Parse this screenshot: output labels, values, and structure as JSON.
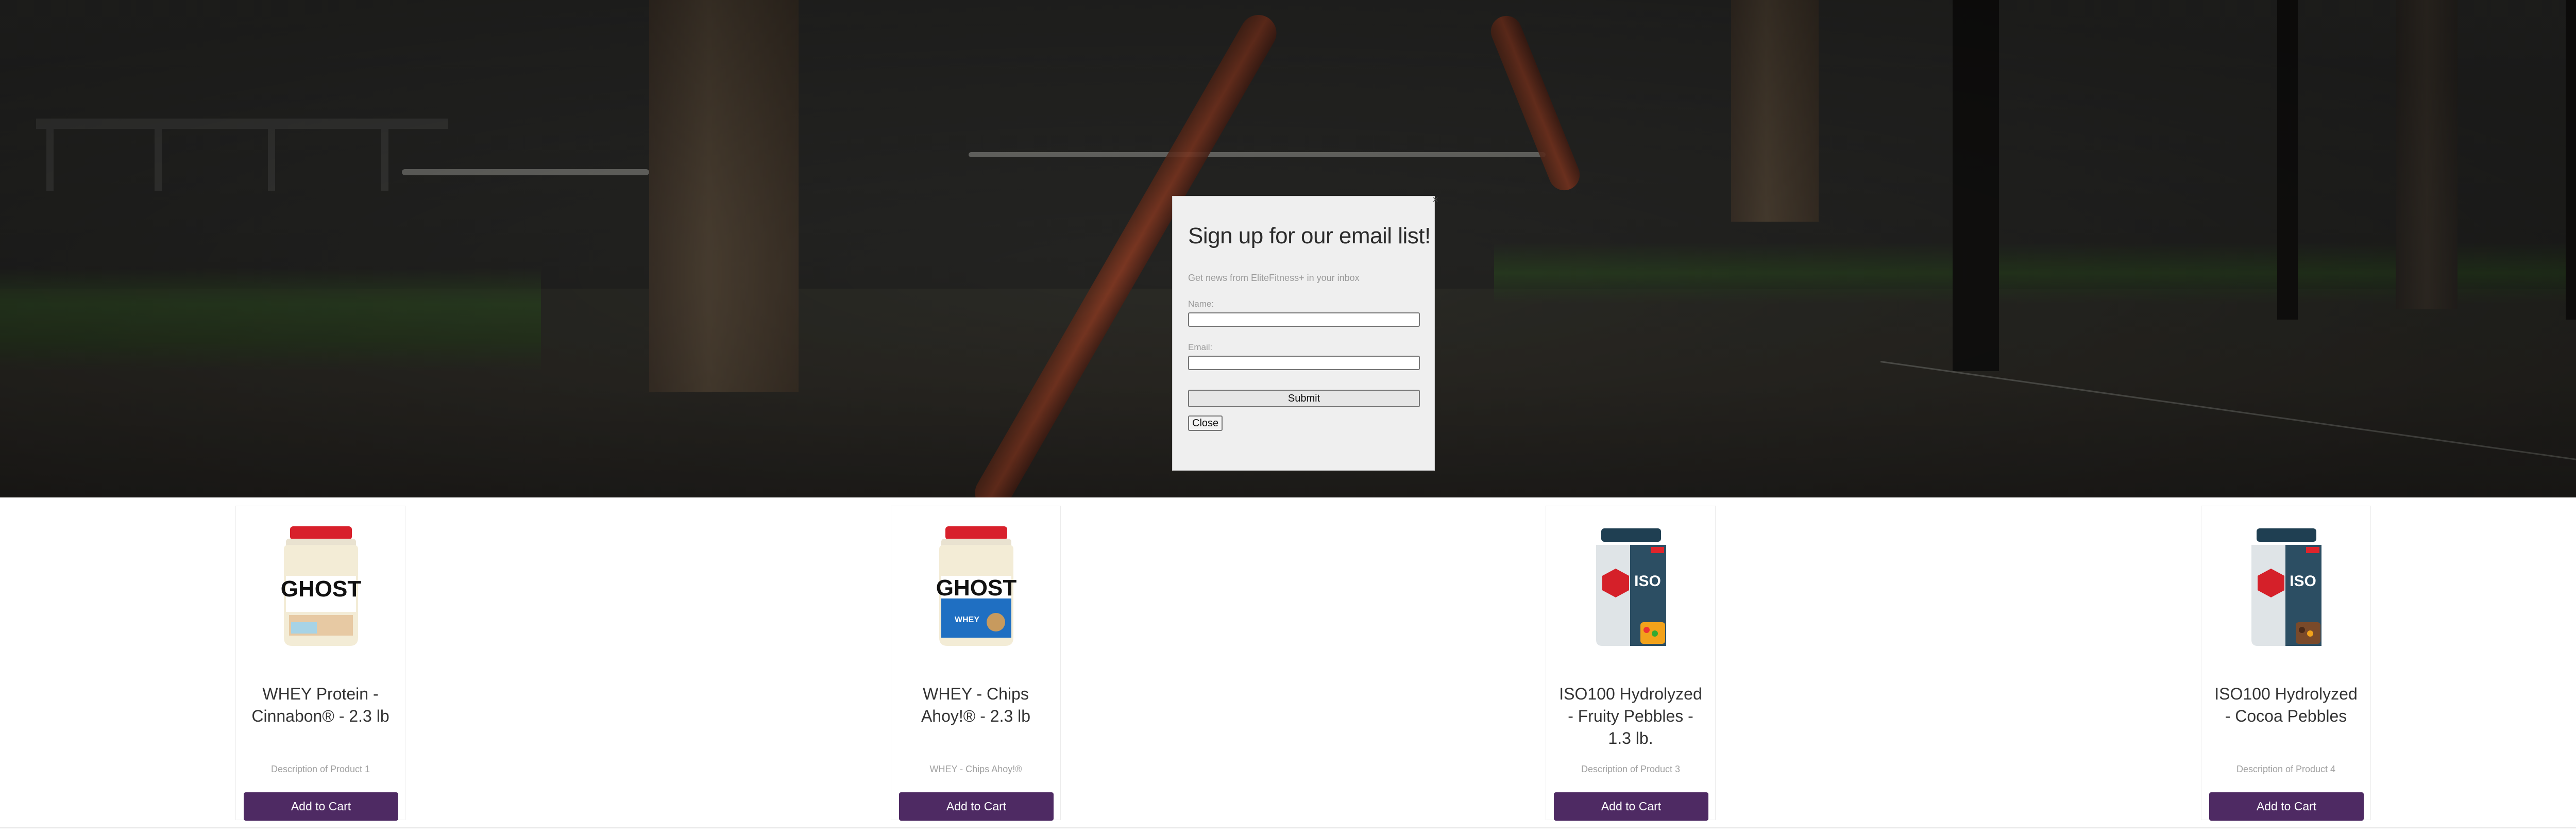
{
  "signup": {
    "title": "Sign up for our email list!",
    "subtitle": "Get news from EliteFitness+ in your inbox",
    "name_label": "Name:",
    "email_label": "Email:",
    "submit_label": "Submit",
    "close_label": "Close",
    "x_mark": "×"
  },
  "products": [
    {
      "name": "WHEY Protein - Cinnabon® - 2.3 lb",
      "description": "Description of Product 1",
      "cta": "Add to Cart",
      "image": "ghost-whey-cinnabon-tub"
    },
    {
      "name": "WHEY - Chips Ahoy!® - 2.3 lb",
      "description": "WHEY - Chips Ahoy!®",
      "cta": "Add to Cart",
      "image": "ghost-whey-chips-ahoy-tub"
    },
    {
      "name": "ISO100 Hydrolyzed - Fruity Pebbles - 1.3 lb.",
      "description": "Description of Product 3",
      "cta": "Add to Cart",
      "image": "iso100-fruity-pebbles-tub"
    },
    {
      "name": "ISO100 Hydrolyzed - Cocoa Pebbles",
      "description": "Description of Product 4",
      "cta": "Add to Cart",
      "image": "iso100-cocoa-pebbles-tub"
    }
  ],
  "colors": {
    "cart_button": "#4e2a63",
    "modal_bg": "#efefef",
    "hero_bg": "#242422"
  }
}
